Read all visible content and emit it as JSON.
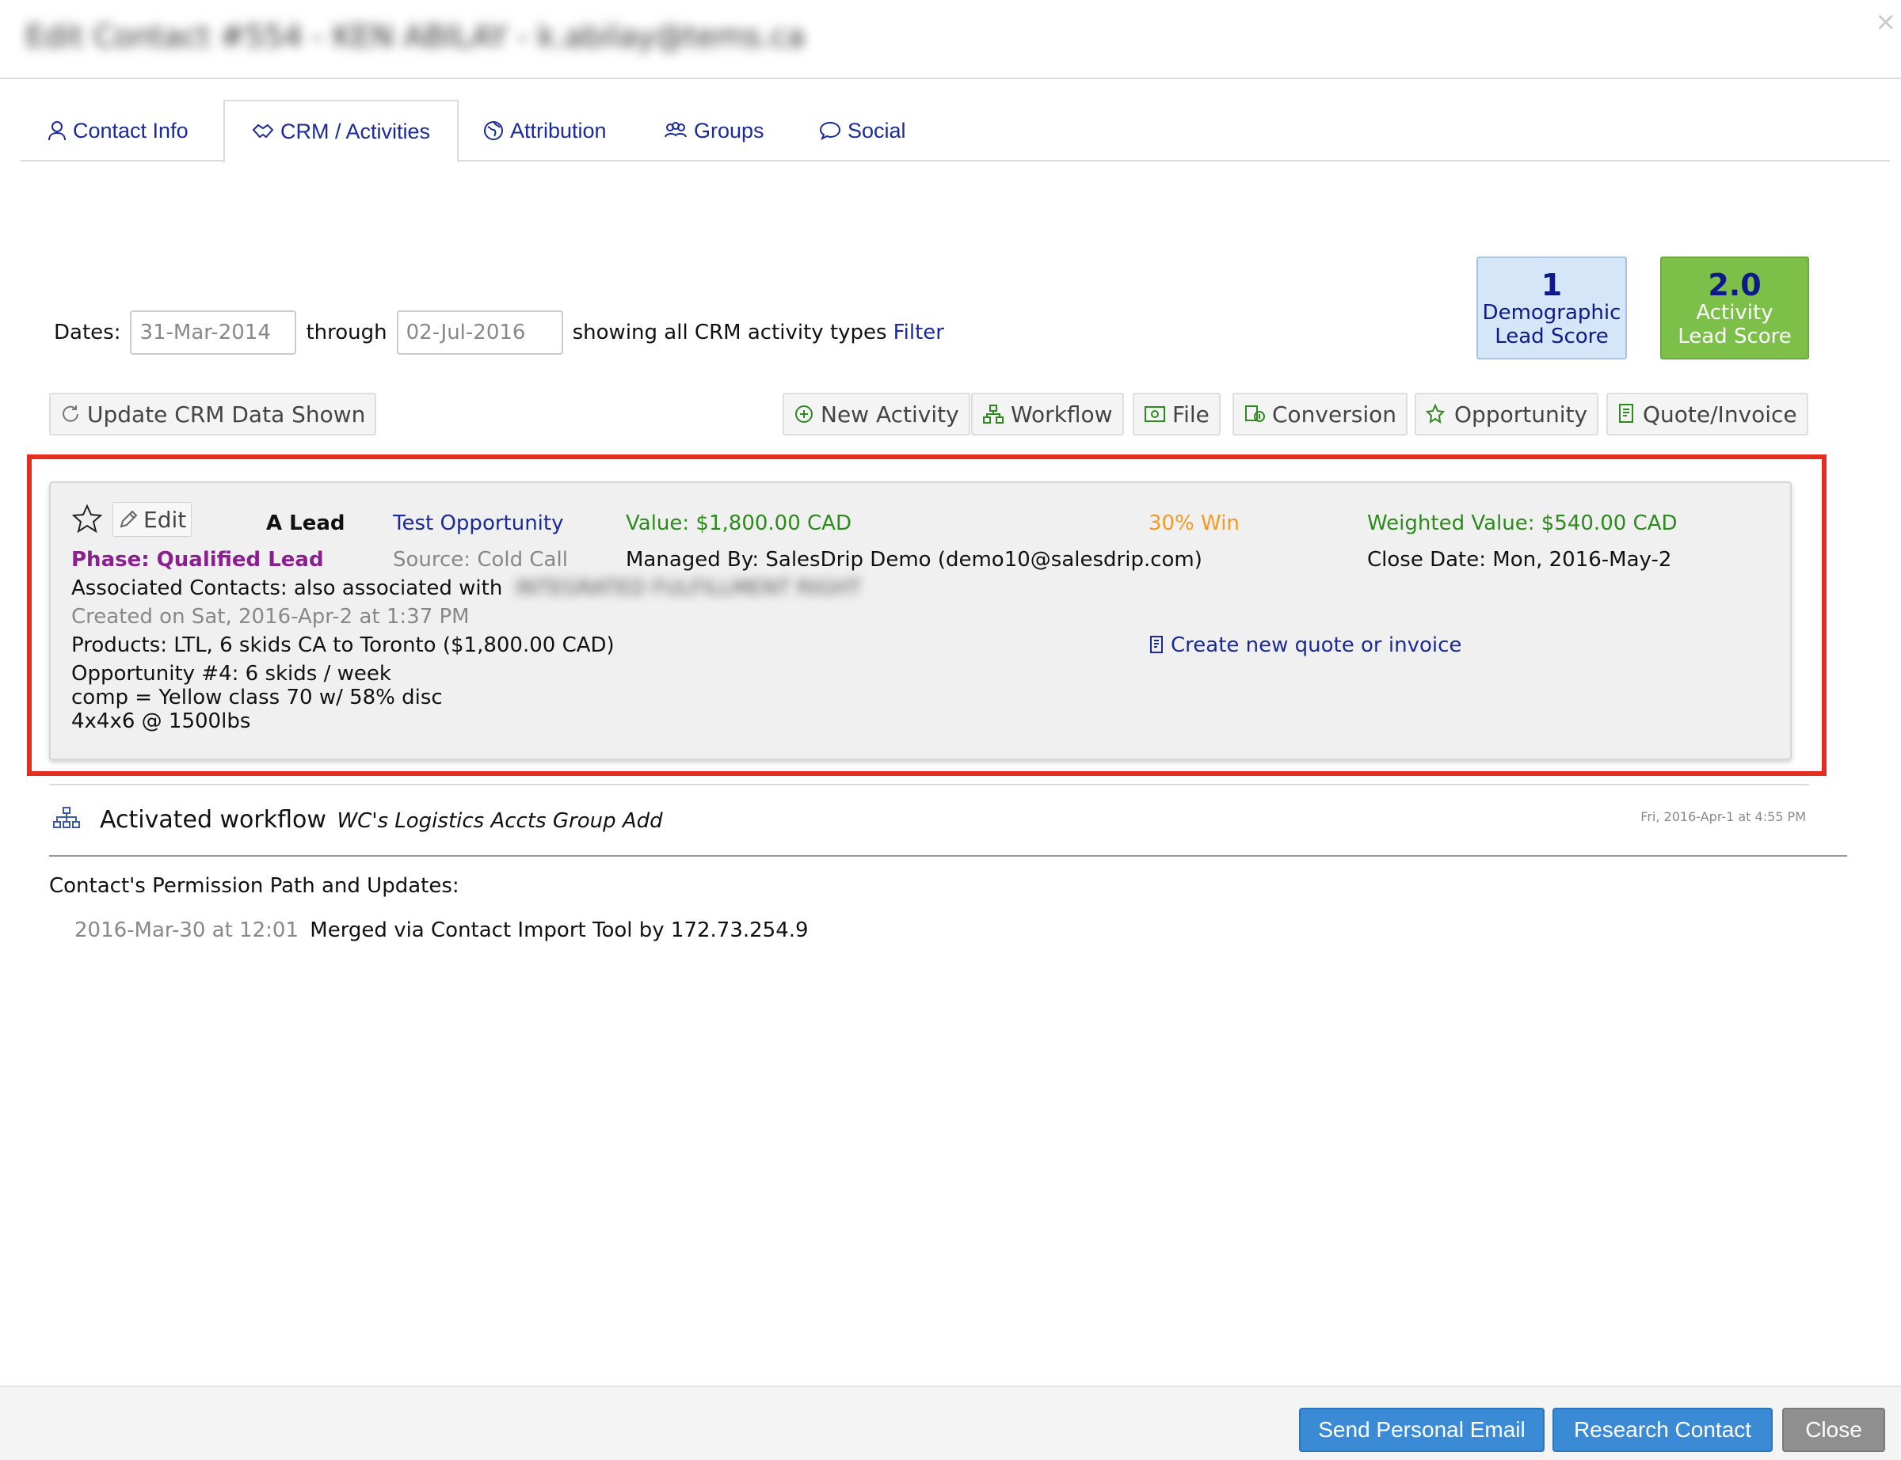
{
  "header": {
    "title": "Edit Contact #554 - KEN ABILAY - k.abilay@tems.ca",
    "close_label": "×"
  },
  "tabs": [
    {
      "label": "Contact Info",
      "active": false
    },
    {
      "label": "CRM / Activities",
      "active": true
    },
    {
      "label": "Attribution",
      "active": false
    },
    {
      "label": "Groups",
      "active": false
    },
    {
      "label": "Social",
      "active": false
    }
  ],
  "filter": {
    "dates_label": "Dates:",
    "from": "31-Mar-2014",
    "through_label": "through",
    "to": "02-Jul-2016",
    "showing_text": "showing all CRM activity types",
    "filter_link": "Filter"
  },
  "scores": {
    "demographic": {
      "value": "1",
      "line1": "Demographic",
      "line2": "Lead Score"
    },
    "activity": {
      "value": "2.0",
      "line1": "Activity",
      "line2": "Lead Score"
    }
  },
  "toolbar": {
    "update_label": "Update CRM Data Shown",
    "new_activity": "New Activity",
    "workflow": "Workflow",
    "file": "File",
    "conversion": "Conversion",
    "opportunity": "Opportunity",
    "quote_invoice": "Quote/Invoice"
  },
  "opportunity": {
    "edit_label": "Edit",
    "lead_type": "A Lead",
    "name": "Test Opportunity",
    "value": "Value: $1,800.00 CAD",
    "win": "30% Win",
    "weighted": "Weighted Value: $540.00 CAD",
    "phase": "Phase: Qualified Lead",
    "source": "Source: Cold Call",
    "managed_by": "Managed By: SalesDrip Demo (demo10@salesdrip.com)",
    "close_date": "Close Date: Mon, 2016-May-2",
    "associated_label": "Associated Contacts: also associated with",
    "associated_blurred": "INTEGRATED FULFILLMENT RIGHT",
    "created": "Created on Sat, 2016-Apr-2 at 1:37 PM",
    "products": "Products: LTL, 6 skids CA to Toronto ($1,800.00 CAD)",
    "create_quote": "Create new quote or invoice",
    "notes": [
      "Opportunity #4: 6 skids / week",
      "comp = Yellow class 70 w/ 58% disc",
      "4x4x6 @ 1500lbs"
    ]
  },
  "workflow_entry": {
    "label": "Activated workflow",
    "name": "WC's Logistics Accts Group Add",
    "timestamp": "Fri, 2016-Apr-1 at 4:55 PM"
  },
  "permission": {
    "title": "Contact's Permission Path and Updates:",
    "date": "2016-Mar-30 at 12:01",
    "text": "Merged via Contact Import Tool by 172.73.254.9"
  },
  "footer": {
    "send_email": "Send Personal Email",
    "research": "Research Contact",
    "close": "Close"
  },
  "colors": {
    "link": "#1a2a9a",
    "green": "#2d8a1c",
    "orange": "#f39a25",
    "purple": "#8a1f8f",
    "highlight": "#e52e22",
    "primary_button": "#3a8ad6"
  }
}
